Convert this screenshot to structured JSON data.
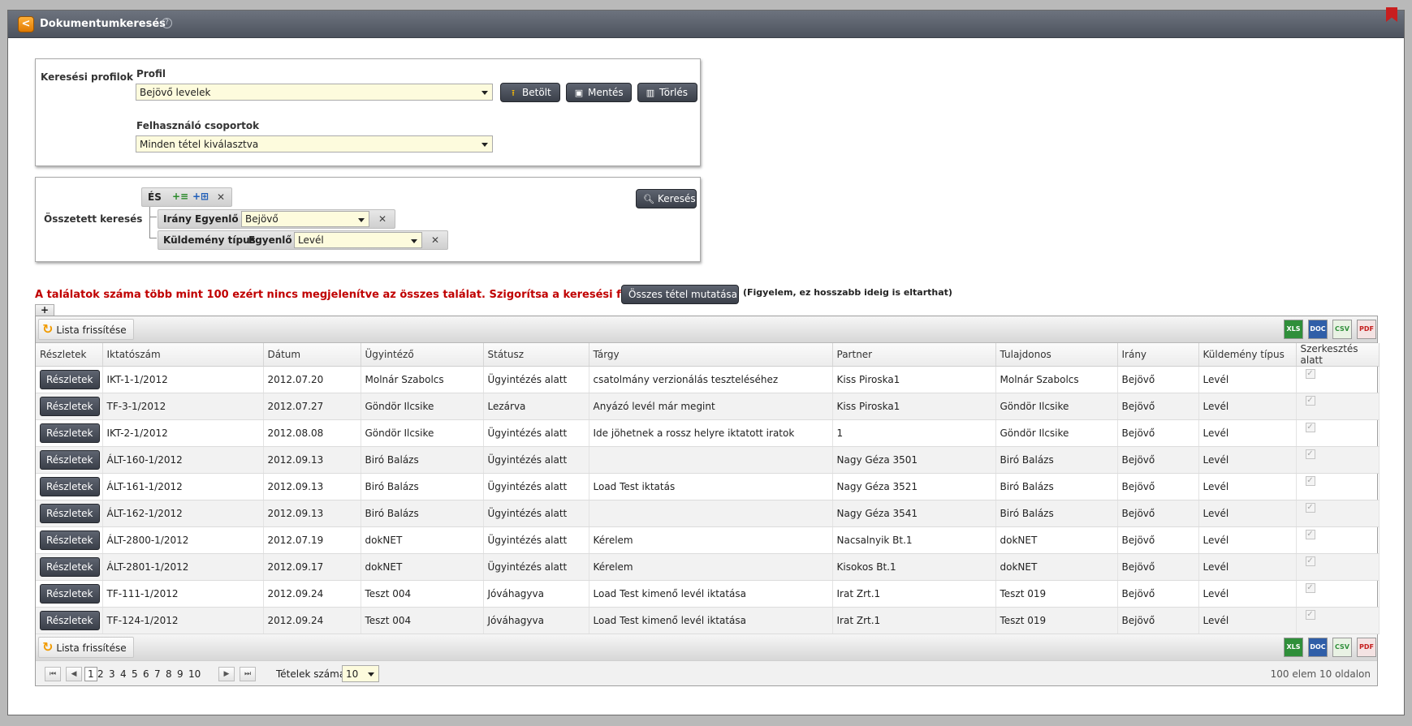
{
  "header": {
    "title": "Dokumentumkeresés",
    "help": "?",
    "back": "<"
  },
  "profiles": {
    "label": "Keresési profilok",
    "profile_label": "Profil",
    "profile_value": "Bejövő levelek",
    "load": "Betölt",
    "save": "Mentés",
    "delete": "Törlés",
    "groups_label": "Felhasználó csoportok",
    "groups_value": "Minden tétel kiválasztva"
  },
  "compound": {
    "label": "Összetett keresés",
    "operator": "ÉS",
    "search": "Keresés",
    "conditions": [
      {
        "field": "Irány",
        "op": "Egyenlő",
        "value": "Bejövő"
      },
      {
        "field": "Küldemény típus",
        "op": "Egyenlő",
        "value": "Levél"
      }
    ]
  },
  "warning": "A találatok száma több mint 100 ezért nincs megjelenítve az összes találat. Szigorítsa a keresési feltételeket.",
  "show_all": "Összes tétel mutatása",
  "note": "(Figyelem, ez hosszabb ideig is eltarthat)",
  "plus": "+",
  "grid": {
    "refresh": "Lista frissítése",
    "exports": [
      "Excel",
      "Word",
      "CSV",
      "PDF"
    ],
    "columns": [
      "Részletek",
      "Iktatószám",
      "Dátum",
      "Ügyintéző",
      "Státusz",
      "Tárgy",
      "Partner",
      "Tulajdonos",
      "Irány",
      "Küldemény típus",
      "Szerkesztés alatt"
    ],
    "details_label": "Részletek",
    "rows": [
      {
        "id": "IKT-1-1/2012",
        "date": "2012.07.20",
        "clerk": "Molnár Szabolcs",
        "status": "Ügyintézés alatt",
        "subject": "csatolmány verzionálás teszteléséhez",
        "partner": "Kiss Piroska1",
        "owner": "Molnár Szabolcs",
        "direction": "Bejövő",
        "type": "Levél"
      },
      {
        "id": "TF-3-1/2012",
        "date": "2012.07.27",
        "clerk": "Göndör Ilcsike",
        "status": "Lezárva",
        "subject": "Anyázó levél már megint",
        "partner": "Kiss Piroska1",
        "owner": "Göndör Ilcsike",
        "direction": "Bejövő",
        "type": "Levél"
      },
      {
        "id": "IKT-2-1/2012",
        "date": "2012.08.08",
        "clerk": "Göndör Ilcsike",
        "status": "Ügyintézés alatt",
        "subject": "Ide jöhetnek a rossz helyre iktatott iratok",
        "partner": "1",
        "owner": "Göndör Ilcsike",
        "direction": "Bejövő",
        "type": "Levél"
      },
      {
        "id": "ÁLT-160-1/2012",
        "date": "2012.09.13",
        "clerk": "Biró Balázs",
        "status": "Ügyintézés alatt",
        "subject": "",
        "partner": "Nagy Géza 3501",
        "owner": "Biró Balázs",
        "direction": "Bejövő",
        "type": "Levél"
      },
      {
        "id": "ÁLT-161-1/2012",
        "date": "2012.09.13",
        "clerk": "Biró Balázs",
        "status": "Ügyintézés alatt",
        "subject": "Load Test iktatás",
        "partner": "Nagy Géza 3521",
        "owner": "Biró Balázs",
        "direction": "Bejövő",
        "type": "Levél"
      },
      {
        "id": "ÁLT-162-1/2012",
        "date": "2012.09.13",
        "clerk": "Biró Balázs",
        "status": "Ügyintézés alatt",
        "subject": "",
        "partner": "Nagy Géza 3541",
        "owner": "Biró Balázs",
        "direction": "Bejövő",
        "type": "Levél"
      },
      {
        "id": "ÁLT-2800-1/2012",
        "date": "2012.07.19",
        "clerk": "dokNET",
        "status": "Ügyintézés alatt",
        "subject": "Kérelem",
        "partner": "Nacsalnyik Bt.1",
        "owner": "dokNET",
        "direction": "Bejövő",
        "type": "Levél"
      },
      {
        "id": "ÁLT-2801-1/2012",
        "date": "2012.09.17",
        "clerk": "dokNET",
        "status": "Ügyintézés alatt",
        "subject": "Kérelem",
        "partner": "Kisokos Bt.1",
        "owner": "dokNET",
        "direction": "Bejövő",
        "type": "Levél"
      },
      {
        "id": "TF-111-1/2012",
        "date": "2012.09.24",
        "clerk": "Teszt 004",
        "status": "Jóváhagyva",
        "subject": "Load Test kimenő levél iktatása",
        "partner": "Irat Zrt.1",
        "owner": "Teszt 019",
        "direction": "Bejövő",
        "type": "Levél"
      },
      {
        "id": "TF-124-1/2012",
        "date": "2012.09.24",
        "clerk": "Teszt 004",
        "status": "Jóváhagyva",
        "subject": "Load Test kimenő levél iktatása",
        "partner": "Irat Zrt.1",
        "owner": "Teszt 019",
        "direction": "Bejövő",
        "type": "Levél"
      }
    ]
  },
  "pager": {
    "pages": [
      "1",
      "2",
      "3",
      "4",
      "5",
      "6",
      "7",
      "8",
      "9",
      "10"
    ],
    "current": "1",
    "size_label": "Tételek száma:",
    "size_value": "10",
    "info": "100 elem 10 oldalon"
  },
  "colors": {
    "warning": "#c00000",
    "accent": "#f19b00",
    "select_bg": "#fdfbdd"
  }
}
